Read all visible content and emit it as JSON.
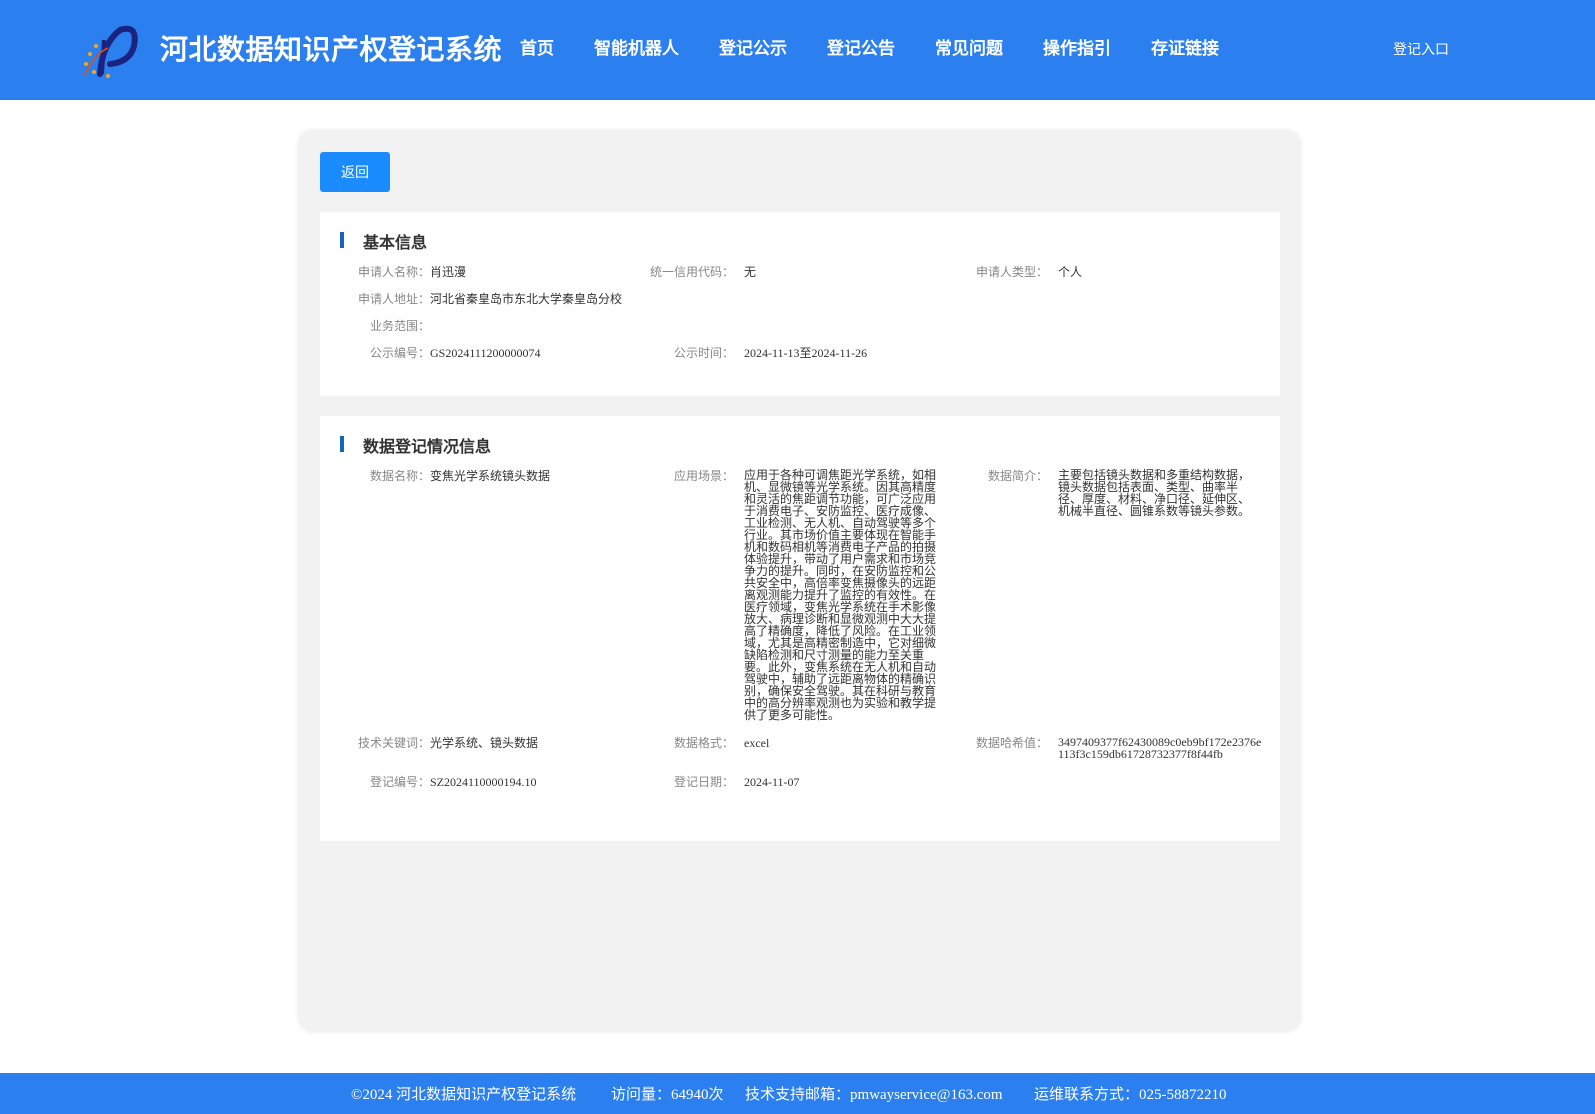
{
  "header": {
    "title": "河北数据知识产权登记系统",
    "nav": [
      "首页",
      "智能机器人",
      "登记公示",
      "登记公告",
      "常见问题",
      "操作指引",
      "存证链接"
    ],
    "login": "登记入口"
  },
  "back_button": "返回",
  "basic": {
    "title": "基本信息",
    "applicant_name_label": "申请人名称：",
    "applicant_name": "肖迅漫",
    "credit_code_label": "统一信用代码：",
    "credit_code": "无",
    "applicant_type_label": "申请人类型：",
    "applicant_type": "个人",
    "address_label": "申请人地址：",
    "address": "河北省秦皇岛市东北大学秦皇岛分校",
    "scope_label": "业务范围：",
    "scope": "",
    "notice_no_label": "公示编号：",
    "notice_no": "GS2024111200000074",
    "notice_time_label": "公示时间：",
    "notice_time": "2024-11-13至2024-11-26"
  },
  "data_info": {
    "title": "数据登记情况信息",
    "data_name_label": "数据名称：",
    "data_name": "变焦光学系统镜头数据",
    "scenario_label": "应用场景：",
    "scenario": "应用于各种可调焦距光学系统，如相机、显微镜等光学系统。因其高精度和灵活的焦距调节功能，可广泛应用于消费电子、安防监控、医疗成像、工业检测、无人机、自动驾驶等多个行业。其市场价值主要体现在智能手机和数码相机等消费电子产品的拍摄体验提升，带动了用户需求和市场竞争力的提升。同时，在安防监控和公共安全中，高倍率变焦摄像头的远距离观测能力提升了监控的有效性。在医疗领域，变焦光学系统在手术影像放大、病理诊断和显微观测中大大提高了精确度，降低了风险。在工业领域，尤其是高精密制造中，它对细微缺陷检测和尺寸测量的能力至关重要。此外，变焦系统在无人机和自动驾驶中，辅助了远距离物体的精确识别，确保安全驾驶。其在科研与教育中的高分辨率观测也为实验和教学提供了更多可能性。",
    "intro_label": "数据简介：",
    "intro": "主要包括镜头数据和多重结构数据，镜头数据包括表面、类型、曲率半径、厚度、材料、净口径、延伸区、机械半直径、圆锥系数等镜头参数。",
    "keywords_label": "技术关键词：",
    "keywords": "光学系统、镜头数据",
    "format_label": "数据格式：",
    "format": "excel",
    "hash_label": "数据哈希值：",
    "hash": "3497409377f62430089c0eb9bf172e2376e113f3c159db61728732377f8f44fb",
    "reg_no_label": "登记编号：",
    "reg_no": "SZ2024110000194.10",
    "reg_date_label": "登记日期：",
    "reg_date": "2024-11-07"
  },
  "footer": {
    "copyright": "©2024 河北数据知识产权登记系统",
    "visits": "访问量：64940次",
    "email": "技术支持邮箱：pmwayservice@163.com",
    "contact": "运维联系方式：025-58872210"
  }
}
